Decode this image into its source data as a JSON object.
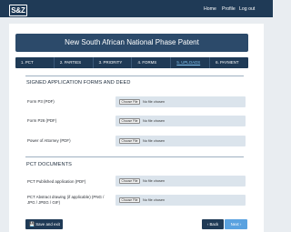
{
  "header": {
    "logo": "S&Z",
    "nav": [
      "Home",
      "Profile",
      "Log out"
    ]
  },
  "page": {
    "title": "New South African National Phase Patent"
  },
  "tabs": [
    {
      "label": "1. PCT"
    },
    {
      "label": "2. PARTIES"
    },
    {
      "label": "3. PRIORITY"
    },
    {
      "label": "4. FORMS"
    },
    {
      "label": "5. UPLOADS"
    },
    {
      "label": "6. PAYMENT"
    }
  ],
  "active_tab": "5. UPLOADS",
  "sections": [
    {
      "title": "SIGNED APPLICATION FORMS AND DEED",
      "fields": [
        {
          "label": "Form P3 (PDF)",
          "button": "Choose File",
          "status": "No file chosen"
        },
        {
          "label": "Form P26 (PDF)",
          "button": "Choose File",
          "status": "No file chosen"
        },
        {
          "label": "Power of Attorney (PDF)",
          "button": "Choose File",
          "status": "No file chosen"
        }
      ]
    },
    {
      "title": "PCT DOCUMENTS",
      "fields": [
        {
          "label": "PCT Published application (PDF)",
          "button": "Choose File",
          "status": "No file chosen"
        },
        {
          "label": "PCT Abstract drawing (if applicable) (PNG / JPG / JPEG / GIF)",
          "button": "Choose File",
          "status": "No file chosen"
        }
      ]
    }
  ],
  "footer": {
    "save_label": "Save and exit",
    "back_label": "Back",
    "next_label": "Next"
  },
  "colors": {
    "navy": "#1f3a56",
    "title_bar": "#2c4a6a",
    "active_tab": "#7fc0ee",
    "next_button": "#5aa2e0",
    "background": "#e9edf1"
  }
}
